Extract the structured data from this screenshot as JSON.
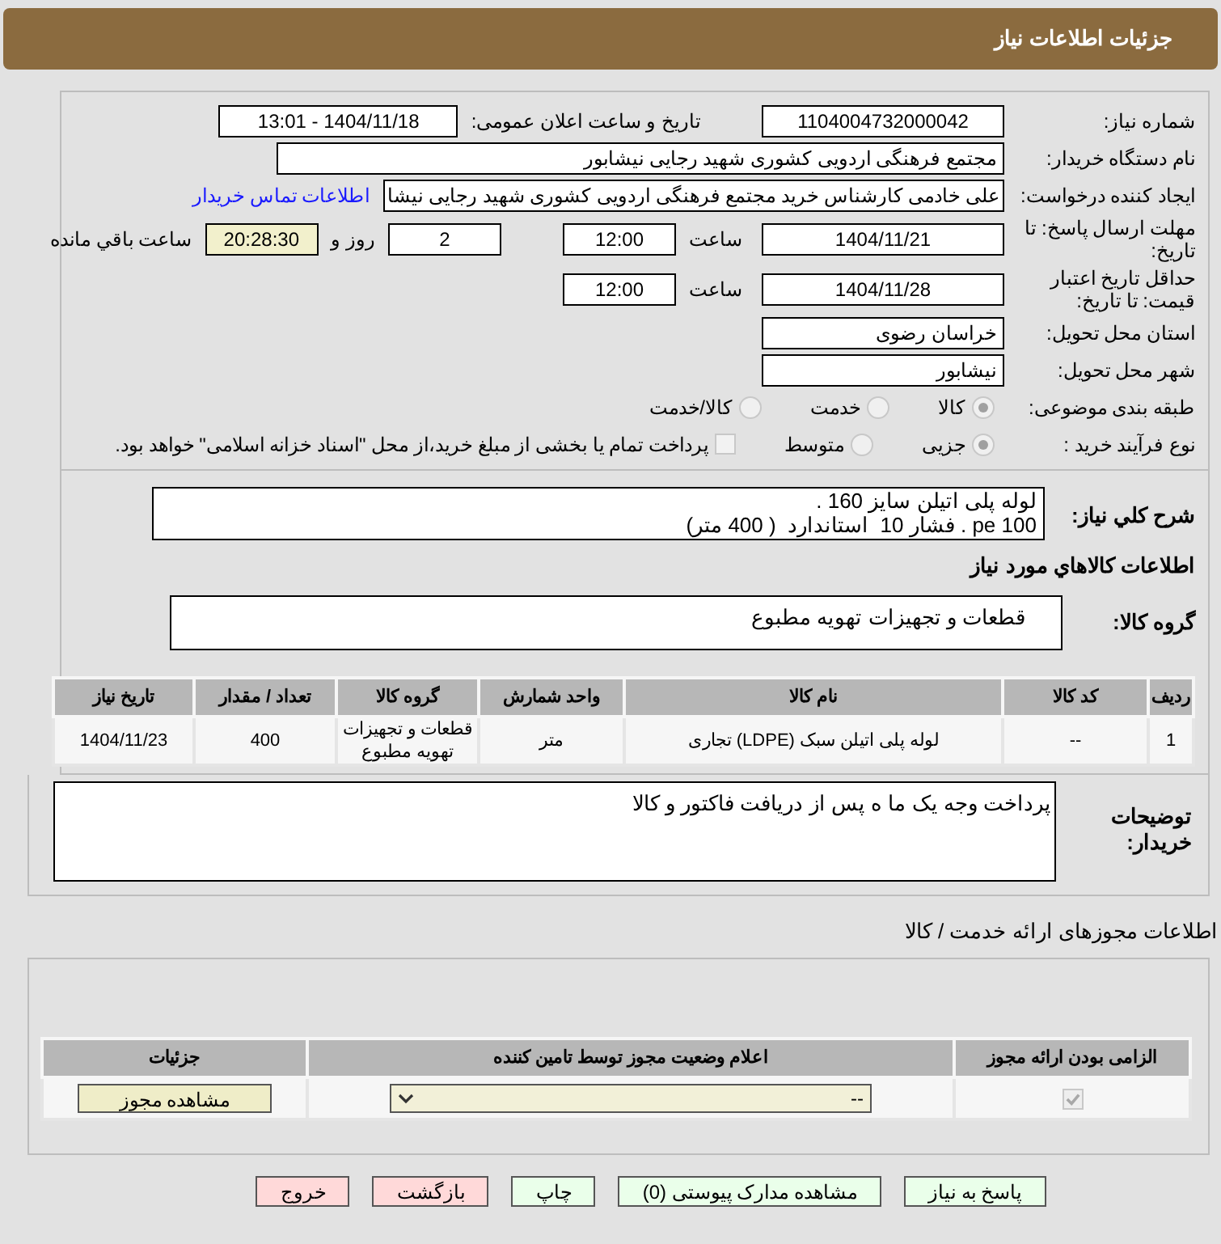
{
  "header": {
    "title": "جزئیات اطلاعات نیاز"
  },
  "need_number": {
    "label": "شماره نیاز:",
    "value": "1104004732000042"
  },
  "announce": {
    "label": "تاریخ و ساعت اعلان عمومی:",
    "value": "1404/11/18 - 13:01"
  },
  "buyer_org": {
    "label": "نام دستگاه خریدار:",
    "value": "مجتمع فرهنگی اردویی کشوری شهید رجایی نیشابور"
  },
  "requester": {
    "label": "ایجاد کننده درخواست:",
    "value": "علی خادمی کارشناس خرید مجتمع فرهنگی اردویی کشوری شهید رجایی نیشا",
    "link": "اطلاعات تماس خریدار"
  },
  "reply_deadline": {
    "label": "مهلت ارسال پاسخ: تا تاریخ:",
    "date": "1404/11/21",
    "time_label": "ساعت",
    "time": "12:00",
    "days": "2",
    "days_label": "روز و",
    "remaining": "20:28:30",
    "remaining_label": "ساعت باقي مانده"
  },
  "price_validity": {
    "label": "حداقل تاریخ اعتبار قیمت: تا تاریخ:",
    "date": "1404/11/28",
    "time_label": "ساعت",
    "time": "12:00"
  },
  "province": {
    "label": "استان محل تحویل:",
    "value": "خراسان رضوی"
  },
  "city": {
    "label": "شهر محل تحویل:",
    "value": "نیشابور"
  },
  "category": {
    "label": "طبقه بندی موضوعی:",
    "options": [
      {
        "label": "کالا",
        "selected": true
      },
      {
        "label": "خدمت",
        "selected": false
      },
      {
        "label": "کالا/خدمت",
        "selected": false
      }
    ]
  },
  "process": {
    "label": "نوع فرآیند خرید :",
    "options": [
      {
        "label": "جزیی",
        "selected": true
      },
      {
        "label": "متوسط",
        "selected": false
      }
    ],
    "payment": {
      "checked": false,
      "text": "پرداخت تمام یا بخشی از مبلغ خرید،از محل \"اسناد خزانه اسلامی\" خواهد بود."
    }
  },
  "description": {
    "label": "شرح کلي نياز:",
    "lines": [
      "لوله پلی اتیلن سایز 160 .",
      "100 pe . فشار 10  استاندارد  ( 400 متر)"
    ]
  },
  "goods_title": "اطلاعات کالاهاي مورد نياز",
  "goods_group": {
    "label": "گروه کالا:",
    "value": "قطعات و تجهیزات تهویه مطبوع"
  },
  "goods_table": {
    "columns": [
      "ردیف",
      "کد کالا",
      "نام کالا",
      "واحد شمارش",
      "گروه کالا",
      "تعداد / مقدار",
      "تاریخ نیاز"
    ],
    "rows": [
      [
        "1",
        "--",
        "لوله پلی اتیلن سبک (LDPE) تجاری",
        "متر",
        "قطعات و تجهیزات تهویه مطبوع",
        "400",
        "1404/11/23"
      ]
    ]
  },
  "buyer_notes": {
    "label": "توضیحات خریدار:",
    "value": "پرداخت وجه یک ما ه پس از دریافت فاکتور و کالا"
  },
  "permits": {
    "title": "اطلاعات مجوزهای ارائه خدمت / کالا",
    "columns": [
      "الزامی بودن ارائه مجوز",
      "اعلام وضعیت مجوز توسط تامین کننده",
      "جزئیات"
    ],
    "rows": [
      {
        "required": true,
        "status": "--",
        "action": "مشاهده مجوز"
      }
    ]
  },
  "buttons": [
    {
      "label": "پاسخ به نیاز",
      "kind": "green"
    },
    {
      "label": "مشاهده مدارک پیوستی (0)",
      "kind": "green"
    },
    {
      "label": "چاپ",
      "kind": "green"
    },
    {
      "label": "بازگشت",
      "kind": "red"
    },
    {
      "label": "خروج",
      "kind": "red"
    }
  ]
}
